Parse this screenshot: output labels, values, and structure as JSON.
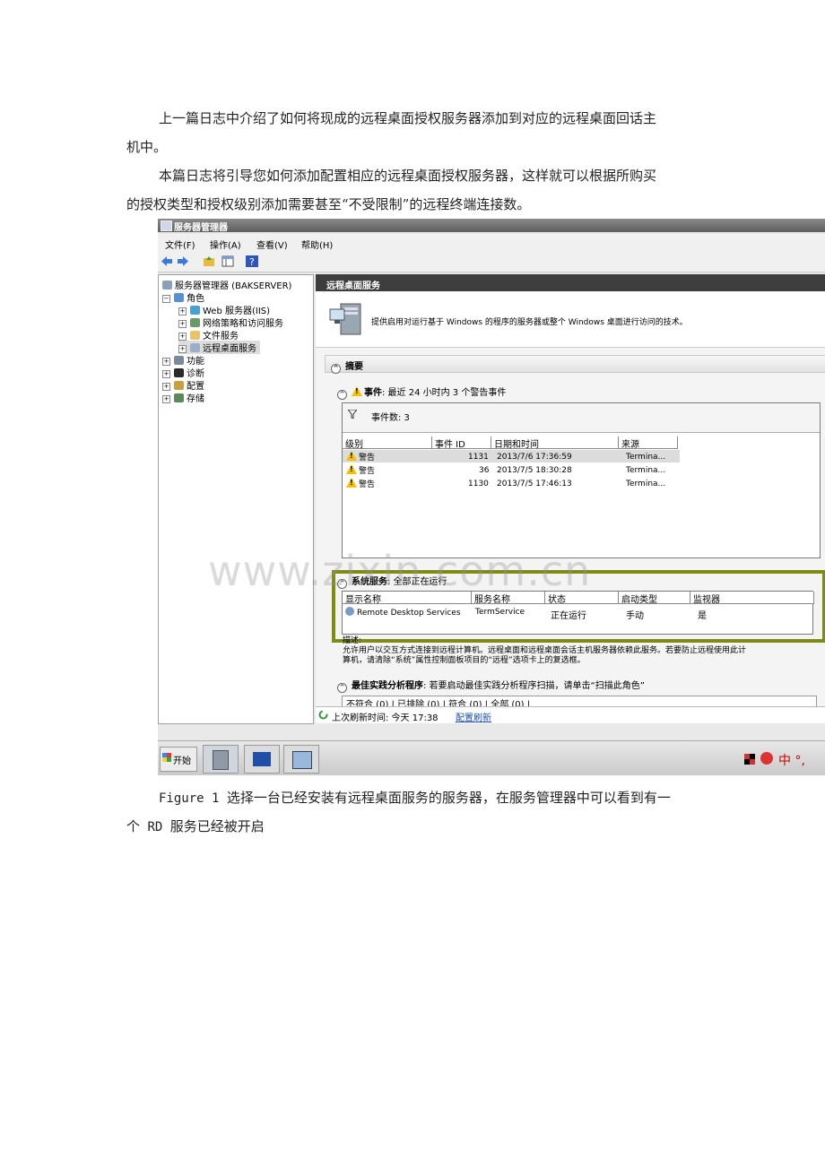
{
  "paragraphs": {
    "p1_line1": "上一篇日志中介绍了如何将现成的远程桌面授权服务器添加到对应的远程桌面回话主",
    "p1_line2": "机中。",
    "p2_line1": "本篇日志将引导您如何添加配置相应的远程桌面授权服务器，这样就可以根据所购买",
    "p2_line2": "的授权类型和授权级别添加需要甚至“不受限制”的远程终端连接数。"
  },
  "caption": {
    "figure_label": "Figure 1",
    "line1_text": "选择一台已经安装有远程桌面服务的服务器，在服务管理器中可以看到有一",
    "line2_prefix": "个",
    "line2_rd": " RD ",
    "line2_suffix": "服务已经被开启"
  },
  "watermark": "www.zixin.com.cn",
  "window": {
    "title": "服务器管理器",
    "menu": [
      "文件(F)",
      "操作(A)",
      "查看(V)",
      "帮助(H)"
    ],
    "tree": {
      "root": "服务器管理器 (BAKSERVER)",
      "roles": "角色",
      "web": "Web 服务器(IIS)",
      "npas": "网络策略和访问服务",
      "files": "文件服务",
      "rds": "远程桌面服务",
      "features": "功能",
      "diag": "诊断",
      "config": "配置",
      "storage": "存储"
    },
    "pane_title": "远程桌面服务",
    "description": "提供启用对运行基于 Windows 的程序的服务器或整个 Windows 桌面进行访问的技术。",
    "summary_label": "摘要",
    "events": {
      "label": "事件",
      "desc": ": 最近 24 小时内 3 个警告事件",
      "count": "事件数: 3",
      "columns": [
        "级别",
        "事件 ID",
        "日期和时间",
        "来源"
      ],
      "rows": [
        {
          "level": "警告",
          "id": "1131",
          "date": "2013/7/6 17:36:59",
          "source": "Termina..."
        },
        {
          "level": "警告",
          "id": "36",
          "date": "2013/7/5 18:30:28",
          "source": "Termina..."
        },
        {
          "level": "警告",
          "id": "1130",
          "date": "2013/7/5 17:46:13",
          "source": "Termina..."
        }
      ]
    },
    "services": {
      "label": "系统服务",
      "desc": ": 全部正在运行",
      "columns": [
        "显示名称",
        "服务名称",
        "状态",
        "启动类型",
        "监视器"
      ],
      "row": {
        "display": "Remote Desktop Services",
        "name": "TermService",
        "status": "正在运行",
        "startup": "手动",
        "monitor": "是"
      },
      "desc_label": "描述:",
      "desc_line1": "允许用户以交互方式连接到远程计算机。远程桌面和远程桌面会话主机服务器依赖此服务。若要防止远程使用此计",
      "desc_line2": "算机，请清除“系统”属性控制面板项目的“远程”选项卡上的复选框。"
    },
    "bpa": {
      "label": "最佳实践分析程序",
      "desc": ": 若要启动最佳实践分析程序扫描，请单击“扫描此角色”",
      "tabs": "不符合 (0) | 已排除 (0) | 符合 (0) | 全部 (0) |"
    },
    "status": {
      "refresh_text": "上次刷新时间: 今天 17:38",
      "refresh_link": "配置刷新"
    },
    "taskbar": {
      "start": "开始",
      "tray": "中 °,"
    },
    "colors": {
      "highlight": "#7f8b13",
      "pane_header": "#3d3d3d",
      "link": "#1a4fa6",
      "warning": "#f2c200"
    }
  }
}
